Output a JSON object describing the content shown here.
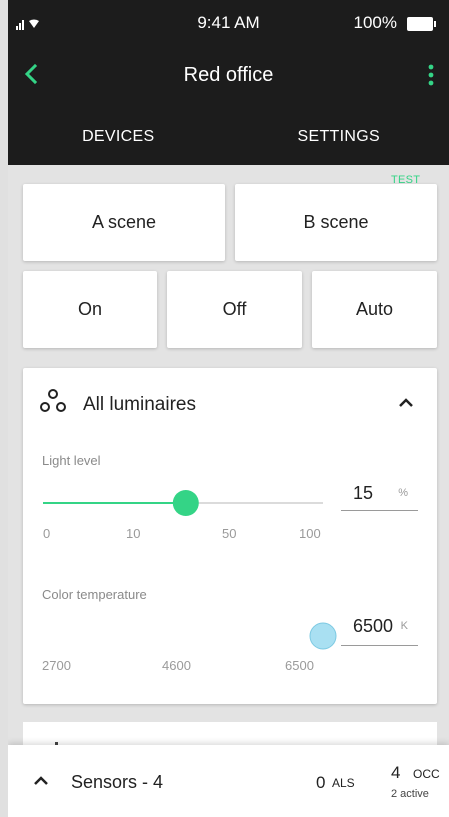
{
  "status": {
    "time": "9:41 AM",
    "battery": "100%"
  },
  "header": {
    "title": "Red office"
  },
  "tabs": [
    {
      "label": "DEVICES"
    },
    {
      "label": "SETTINGS"
    },
    {
      "label": "TEST"
    }
  ],
  "active_tab": "TEST",
  "buttons": {
    "scene_a": "A scene",
    "scene_b": "B scene",
    "on": "On",
    "off": "Off",
    "auto": "Auto"
  },
  "luminaires": {
    "title": "All luminaires",
    "light_level": {
      "label": "Light level",
      "value": "15",
      "unit": "%",
      "ticks": [
        "0",
        "10",
        "50",
        "100"
      ],
      "position_fraction": 0.51
    },
    "color_temperature": {
      "label": "Color temperature",
      "value": "6500",
      "unit": "K",
      "ticks": [
        "2700",
        "4600",
        "6500"
      ],
      "position_fraction": 1.0
    }
  },
  "colors": {
    "accent": "#34d486",
    "topbar": "#1c1c1c",
    "warm": "#f5d54a",
    "cool": "#a9e0f2"
  },
  "sensors": {
    "title": "Sensors - 4",
    "als_count": "0",
    "als_label": "ALS",
    "occ_count": "4",
    "occ_label": "OCC",
    "occ_active": "2 active"
  }
}
